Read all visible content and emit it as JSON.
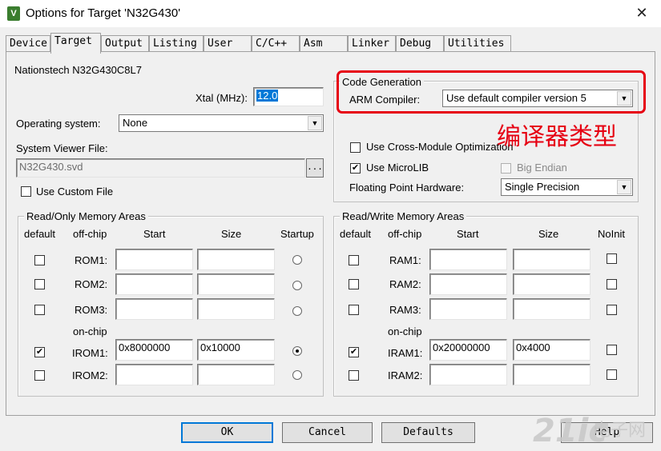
{
  "window": {
    "title": "Options for Target 'N32G430'",
    "icon": "uvision-app-icon",
    "close": "✕"
  },
  "tabs": [
    {
      "label": "Device"
    },
    {
      "label": "Target"
    },
    {
      "label": "Output"
    },
    {
      "label": "Listing"
    },
    {
      "label": "User"
    },
    {
      "label": "C/C++"
    },
    {
      "label": "Asm"
    },
    {
      "label": "Linker"
    },
    {
      "label": "Debug"
    },
    {
      "label": "Utilities"
    }
  ],
  "active_tab": "Target",
  "target": {
    "device_name": "Nationstech N32G430C8L7",
    "xtal_label": "Xtal (MHz):",
    "xtal_value": "12.0",
    "os_label": "Operating system:",
    "os_value": "None",
    "svd_label": "System Viewer File:",
    "svd_value": "N32G430.svd",
    "browse_label": "...",
    "custom_file_label": "Use Custom File",
    "custom_file_checked": false
  },
  "codegen": {
    "group_title": "Code Generation",
    "compiler_label": "ARM Compiler:",
    "compiler_value": "Use default compiler version 5",
    "cross_module_label": "Use Cross-Module Optimization",
    "cross_module_checked": false,
    "microlib_label": "Use MicroLIB",
    "microlib_checked": true,
    "big_endian_label": "Big Endian",
    "big_endian_checked": false,
    "fpu_label": "Floating Point Hardware:",
    "fpu_value": "Single Precision"
  },
  "annotation": "编译器类型",
  "readonly_mem": {
    "group_title": "Read/Only Memory Areas",
    "headers": {
      "default": "default",
      "offchip": "off-chip",
      "start": "Start",
      "size": "Size",
      "startup": "Startup"
    },
    "onchip_label": "on-chip",
    "rows": [
      {
        "name": "ROM1:",
        "start": "",
        "size": "",
        "default": false,
        "startup": false
      },
      {
        "name": "ROM2:",
        "start": "",
        "size": "",
        "default": false,
        "startup": false
      },
      {
        "name": "ROM3:",
        "start": "",
        "size": "",
        "default": false,
        "startup": false
      },
      {
        "name": "IROM1:",
        "start": "0x8000000",
        "size": "0x10000",
        "default": true,
        "startup": true
      },
      {
        "name": "IROM2:",
        "start": "",
        "size": "",
        "default": false,
        "startup": false
      }
    ]
  },
  "readwrite_mem": {
    "group_title": "Read/Write Memory Areas",
    "headers": {
      "default": "default",
      "offchip": "off-chip",
      "start": "Start",
      "size": "Size",
      "noinit": "NoInit"
    },
    "onchip_label": "on-chip",
    "rows": [
      {
        "name": "RAM1:",
        "start": "",
        "size": "",
        "default": false,
        "noinit": false
      },
      {
        "name": "RAM2:",
        "start": "",
        "size": "",
        "default": false,
        "noinit": false
      },
      {
        "name": "RAM3:",
        "start": "",
        "size": "",
        "default": false,
        "noinit": false
      },
      {
        "name": "IRAM1:",
        "start": "0x20000000",
        "size": "0x4000",
        "default": true,
        "noinit": false
      },
      {
        "name": "IRAM2:",
        "start": "",
        "size": "",
        "default": false,
        "noinit": false
      }
    ]
  },
  "buttons": {
    "ok": "OK",
    "cancel": "Cancel",
    "defaults": "Defaults",
    "help": "Help"
  },
  "watermark": {
    "main": "21ic",
    "sub": "电子网"
  },
  "colors": {
    "annotation_red": "#e60012",
    "selection_blue": "#0078d7"
  }
}
